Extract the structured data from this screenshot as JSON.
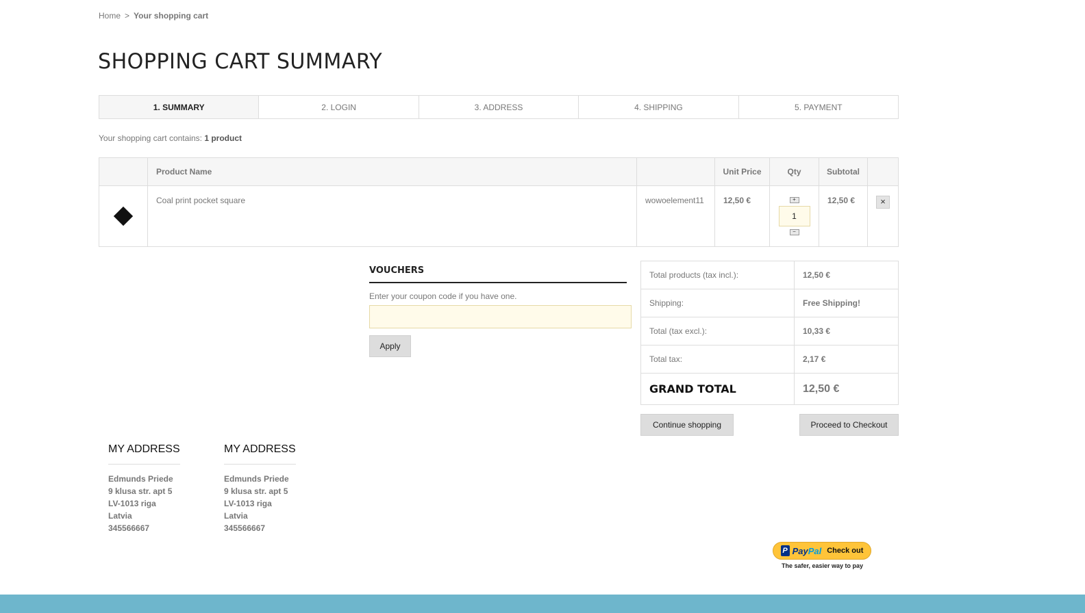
{
  "breadcrumb": {
    "home": "Home",
    "separator": ">",
    "current": "Your shopping cart"
  },
  "page_title": "SHOPPING CART SUMMARY",
  "steps": [
    {
      "label": "1. SUMMARY",
      "active": true
    },
    {
      "label": "2. LOGIN"
    },
    {
      "label": "3. ADDRESS"
    },
    {
      "label": "4. SHIPPING"
    },
    {
      "label": "5. PAYMENT"
    }
  ],
  "cart_summary": {
    "prefix": "Your shopping cart contains:",
    "count": "1 product"
  },
  "cart_table": {
    "headers": {
      "product_name": "Product Name",
      "unit_price": "Unit Price",
      "qty": "Qty",
      "subtotal": "Subtotal"
    },
    "rows": [
      {
        "image_icon": "diamond-shape",
        "product_name": "Coal print pocket square",
        "reference": "wowoelement11",
        "unit_price": "12,50 €",
        "qty": "1",
        "subtotal": "12,50 €",
        "qty_up_symbol": "+",
        "qty_down_symbol": "−",
        "delete_symbol": "×"
      }
    ]
  },
  "vouchers": {
    "title": "VOUCHERS",
    "hint": "Enter your coupon code if you have one.",
    "input_value": "",
    "apply_label": "Apply"
  },
  "totals": {
    "products_label": "Total products (tax incl.):",
    "products_value": "12,50 €",
    "shipping_label": "Shipping:",
    "shipping_value": "Free Shipping!",
    "excl_label": "Total (tax excl.):",
    "excl_value": "10,33 €",
    "tax_label": "Total tax:",
    "tax_value": "2,17 €",
    "grand_label": "GRAND TOTAL",
    "grand_value": "12,50 €"
  },
  "actions": {
    "continue_label": "Continue shopping",
    "checkout_label": "Proceed to Checkout"
  },
  "addresses": [
    {
      "title": "MY ADDRESS",
      "lines": [
        "Edmunds Priede",
        "9 klusa str. apt 5",
        "LV-1013 riga",
        "Latvia",
        "345566667"
      ]
    },
    {
      "title": "MY ADDRESS",
      "lines": [
        "Edmunds Priede",
        "9 klusa str. apt 5",
        "LV-1013 riga",
        "Latvia",
        "345566667"
      ]
    }
  ],
  "paypal": {
    "mark": "P",
    "word_pay": "Pay",
    "word_pal": "Pal",
    "check_out": "Check out",
    "tagline": "The safer, easier way to pay"
  },
  "colors": {
    "accent_price": "#f0ad4e",
    "footer": "#6eb6cc",
    "input_bg": "#fffbea"
  }
}
